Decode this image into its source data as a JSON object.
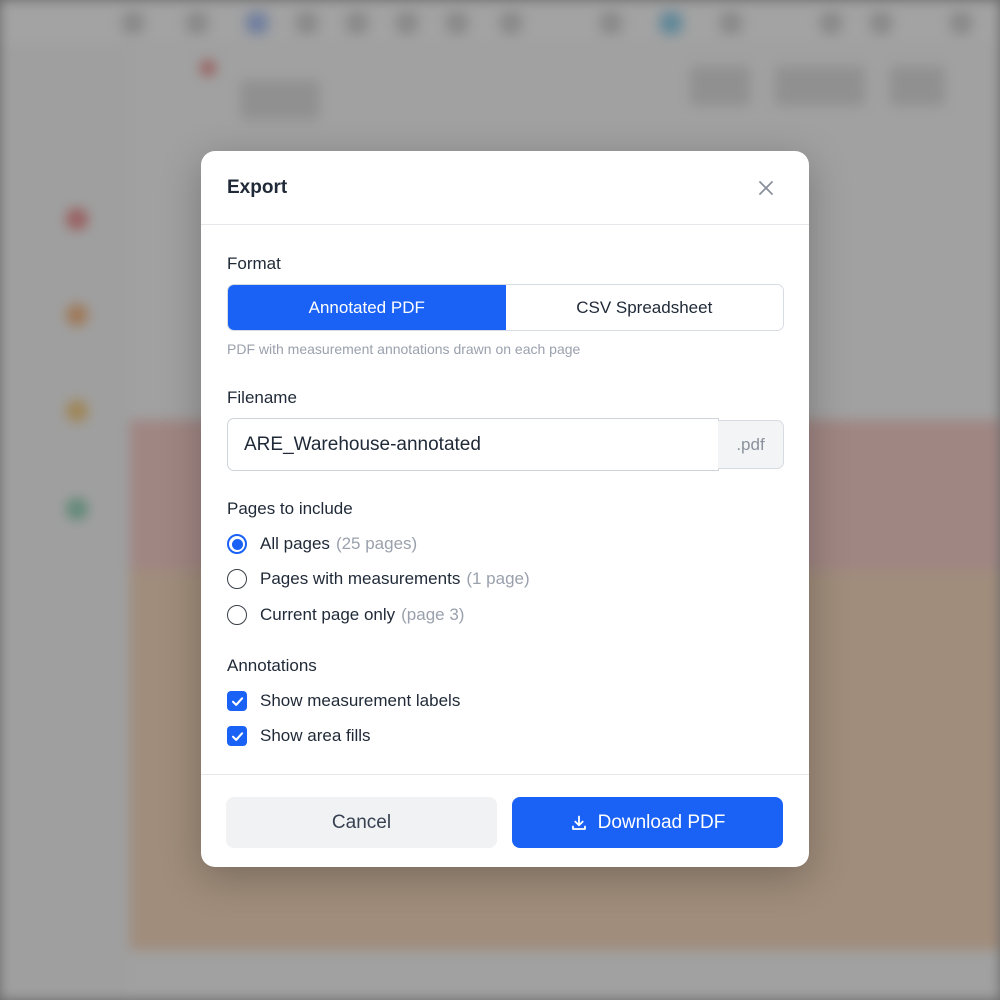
{
  "dialog": {
    "title": "Export",
    "format": {
      "label": "Format",
      "options": [
        "Annotated PDF",
        "CSV Spreadsheet"
      ],
      "selected": "Annotated PDF",
      "hint": "PDF with measurement annotations drawn on each page"
    },
    "filename": {
      "label": "Filename",
      "value": "ARE_Warehouse-annotated",
      "suffix": ".pdf"
    },
    "pages": {
      "label": "Pages to include",
      "options": [
        {
          "label": "All pages",
          "note": "(25 pages)",
          "checked": true
        },
        {
          "label": "Pages with measurements",
          "note": "(1 page)",
          "checked": false
        },
        {
          "label": "Current page only",
          "note": "(page 3)",
          "checked": false
        }
      ]
    },
    "annotations": {
      "label": "Annotations",
      "options": [
        {
          "label": "Show measurement labels",
          "checked": true
        },
        {
          "label": "Show area fills",
          "checked": true
        }
      ]
    },
    "footer": {
      "cancel_label": "Cancel",
      "download_label": "Download PDF"
    }
  },
  "colors": {
    "accent": "#1a62f5",
    "text": "#1f2937",
    "muted": "#9aa1ad"
  },
  "icons": {
    "close": "close-icon",
    "download": "download-icon",
    "check": "check-icon"
  }
}
